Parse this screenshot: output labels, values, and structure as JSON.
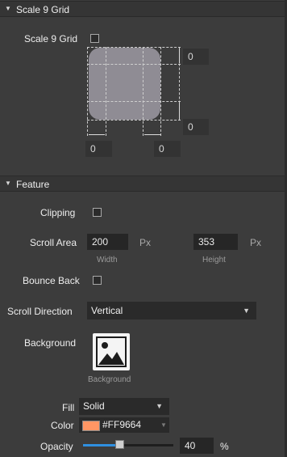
{
  "scale9": {
    "header": "Scale 9 Grid",
    "label": "Scale 9 Grid",
    "checked": false,
    "top_value": "0",
    "bottom_value": "0",
    "left_value": "0",
    "right_value": "0"
  },
  "feature": {
    "header": "Feature",
    "clipping_label": "Clipping",
    "clipping_checked": false,
    "scroll_area_label": "Scroll Area",
    "width_value": "200",
    "width_unit": "Px",
    "width_caption": "Width",
    "height_value": "353",
    "height_unit": "Px",
    "height_caption": "Height",
    "bounce_back_label": "Bounce Back",
    "bounce_back_checked": false,
    "scroll_direction_label": "Scroll Direction",
    "scroll_direction_value": "Vertical",
    "background_label": "Background",
    "background_caption": "Background",
    "fill_label": "Fill",
    "fill_value": "Solid",
    "color_label": "Color",
    "color_hex": "#FF9664",
    "opacity_label": "Opacity",
    "opacity_value": "40",
    "opacity_unit": "%",
    "opacity_fraction": 0.4
  },
  "colors": {
    "accent": "#2f8fe0",
    "swatch": "#FF9664"
  }
}
